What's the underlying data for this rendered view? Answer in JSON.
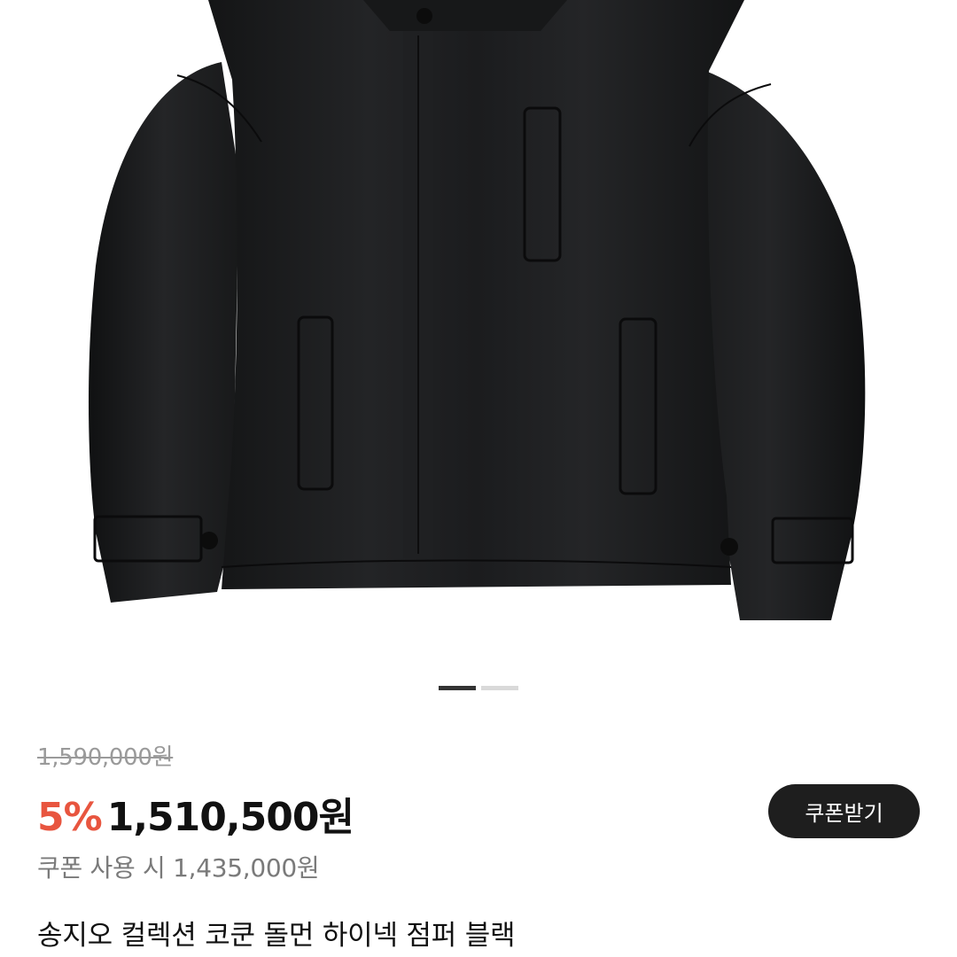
{
  "product": {
    "image_alt": "black cocoon down high-neck jumper",
    "image_count": 2,
    "active_image": 1,
    "original_price": "1,590,000원",
    "discount_rate": "5%",
    "sale_price": "1,510,500원",
    "coupon_button_label": "쿠폰받기",
    "coupon_price": "쿠폰 사용 시 1,435,000원",
    "title": "송지오 컬렉션 코쿤 돌먼 하이넥 점퍼 블랙"
  },
  "colors": {
    "discount": "#e8553f",
    "button_bg": "#1e1e1e",
    "jacket": "#1c1d1f"
  },
  "icons": {
    "product-image": "jacket-photo"
  }
}
